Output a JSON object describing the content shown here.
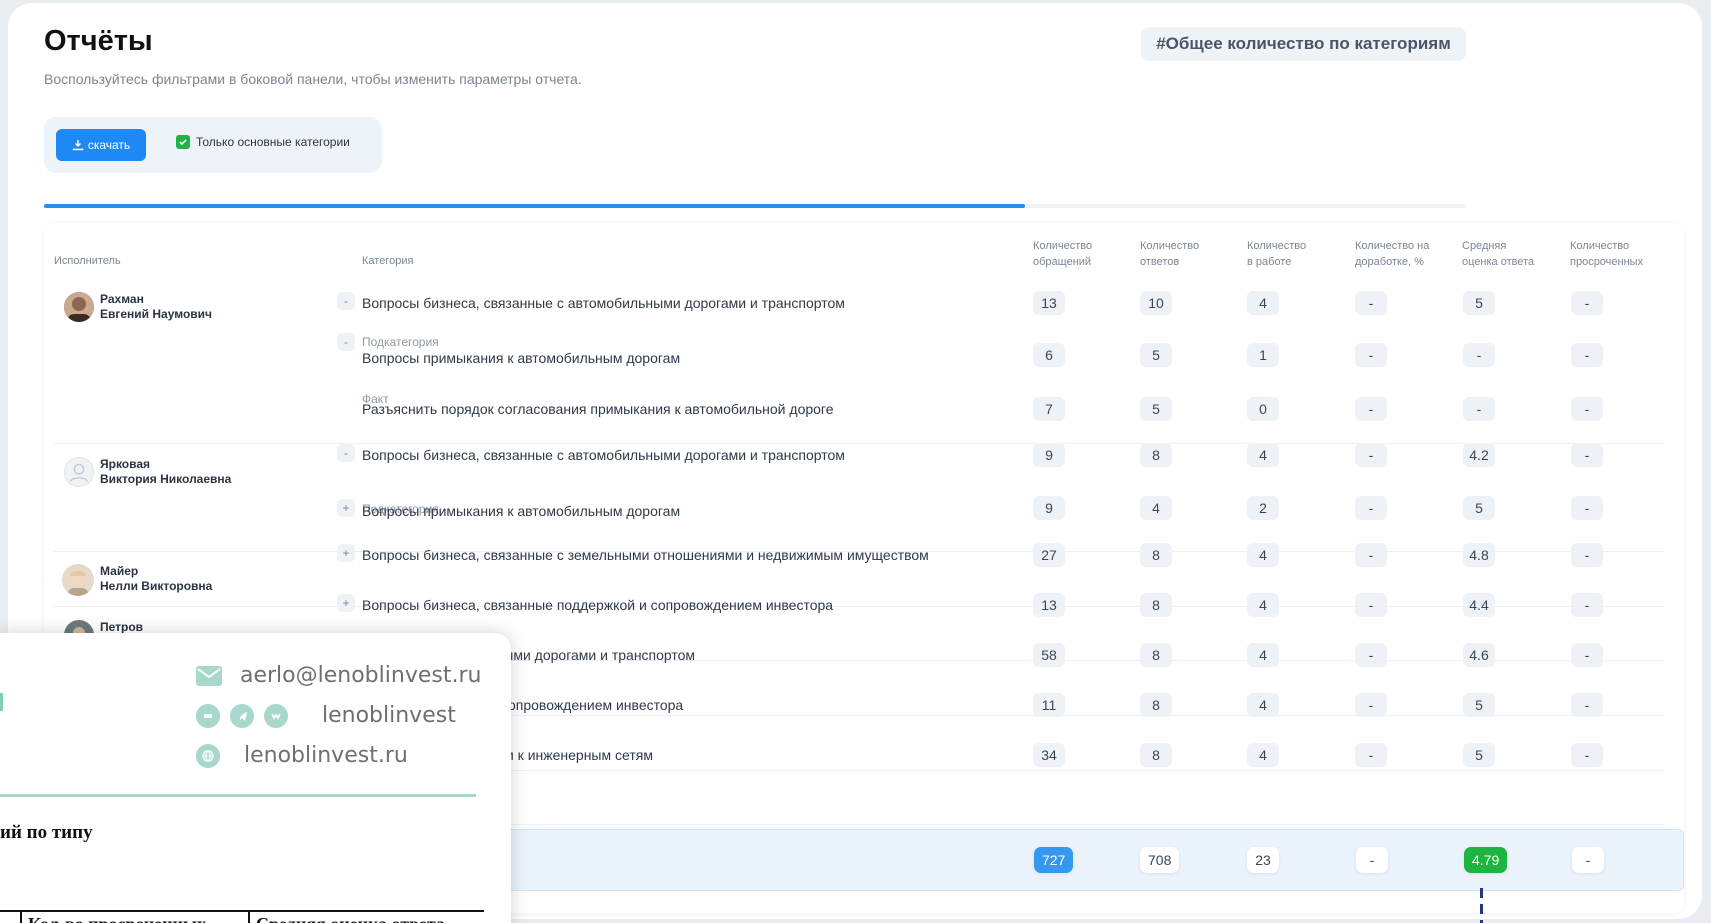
{
  "header": {
    "title": "Отчёты",
    "subtitle": "Воспользуйтесь фильтрами в боковой панели, чтобы изменить параметры отчета.",
    "hashtag": "#Общее количество по категориям"
  },
  "toolbar": {
    "download_label": "скачать",
    "main_categories_label": "Только основные категории",
    "main_categories_checked": true
  },
  "progress": {
    "fraction": 0.69
  },
  "table": {
    "columns": {
      "executor": "Исполнитель",
      "category": "Категория",
      "requests": [
        "Количество",
        "обращений"
      ],
      "answers": [
        "Количество",
        "ответов"
      ],
      "in_work": [
        "Количество",
        "в работе"
      ],
      "revision": [
        "Количество на",
        "доработке, %"
      ],
      "avg_score": [
        "Средняя",
        "оценка ответа"
      ],
      "overdue": [
        "Количество",
        "просроченных"
      ]
    },
    "sub_labels": {
      "subcategory": "Подкатегория",
      "fact": "Факт"
    },
    "executors": [
      {
        "last": "Рахман",
        "first": "Евгений Наумович"
      },
      {
        "last": "Ярковая",
        "first": "Виктория Николаевна"
      },
      {
        "last": "Майер",
        "first": "Нелли Викторовна"
      },
      {
        "last": "Петров",
        "first": ""
      }
    ],
    "rows": [
      {
        "toggle": "-",
        "category": "Вопросы бизнеса, связанные с автомобильными дорогами и транспортом",
        "requests": "13",
        "answers": "10",
        "in_work": "4",
        "revision": "-",
        "avg": "5",
        "overdue": "-"
      },
      {
        "toggle": "-",
        "category": "Вопросы примыкания к автомобильным дорогам",
        "requests": "6",
        "answers": "5",
        "in_work": "1",
        "revision": "-",
        "avg": "-",
        "overdue": "-"
      },
      {
        "toggle": "",
        "category": "Разъяснить порядок согласования примыкания к автомобильной дороге",
        "requests": "7",
        "answers": "5",
        "in_work": "0",
        "revision": "-",
        "avg": "-",
        "overdue": "-"
      },
      {
        "toggle": "-",
        "category": "Вопросы бизнеса, связанные с автомобильными дорогами и транспортом",
        "requests": "9",
        "answers": "8",
        "in_work": "4",
        "revision": "-",
        "avg": "4.2",
        "overdue": "-"
      },
      {
        "toggle": "+",
        "category": "Вопросы примыкания к автомобильным дорогам",
        "requests": "9",
        "answers": "4",
        "in_work": "2",
        "revision": "-",
        "avg": "5",
        "overdue": "-"
      },
      {
        "toggle": "+",
        "category": "Вопросы бизнеса, связанные с земельными отношениями и недвижимым имуществом",
        "requests": "27",
        "answers": "8",
        "in_work": "4",
        "revision": "-",
        "avg": "4.8",
        "overdue": "-"
      },
      {
        "toggle": "+",
        "category": "Вопросы бизнеса, связанные поддержкой и сопровождением инвестора",
        "requests": "13",
        "answers": "8",
        "in_work": "4",
        "revision": "-",
        "avg": "4.4",
        "overdue": "-"
      },
      {
        "toggle": "",
        "category": "анные с автомобильными дорогами и транспортом",
        "requests": "58",
        "answers": "8",
        "in_work": "4",
        "revision": "-",
        "avg": "4.6",
        "overdue": "-"
      },
      {
        "toggle": "",
        "category": "анные поддержкой и сопровождением инвестора",
        "requests": "11",
        "answers": "8",
        "in_work": "4",
        "revision": "-",
        "avg": "5",
        "overdue": "-"
      },
      {
        "toggle": "",
        "category": "анные с подключением к инженерным сетям",
        "requests": "34",
        "answers": "8",
        "in_work": "4",
        "revision": "-",
        "avg": "5",
        "overdue": "-"
      }
    ],
    "totals": {
      "requests": "727",
      "answers": "708",
      "in_work": "23",
      "revision": "-",
      "avg": "4.79",
      "overdue": "-"
    }
  },
  "overlay": {
    "email": "aerlo@lenoblinvest.ru",
    "social": "lenoblinvest",
    "website": "lenoblinvest.ru",
    "heading": "ий по типу",
    "table_headers": [
      "Кол-во просроченных",
      "Средняя оценка ответа"
    ]
  },
  "colors": {
    "accent": "#1e88f5",
    "success": "#1db53f",
    "overlay_accent": "#a8d7cc"
  }
}
